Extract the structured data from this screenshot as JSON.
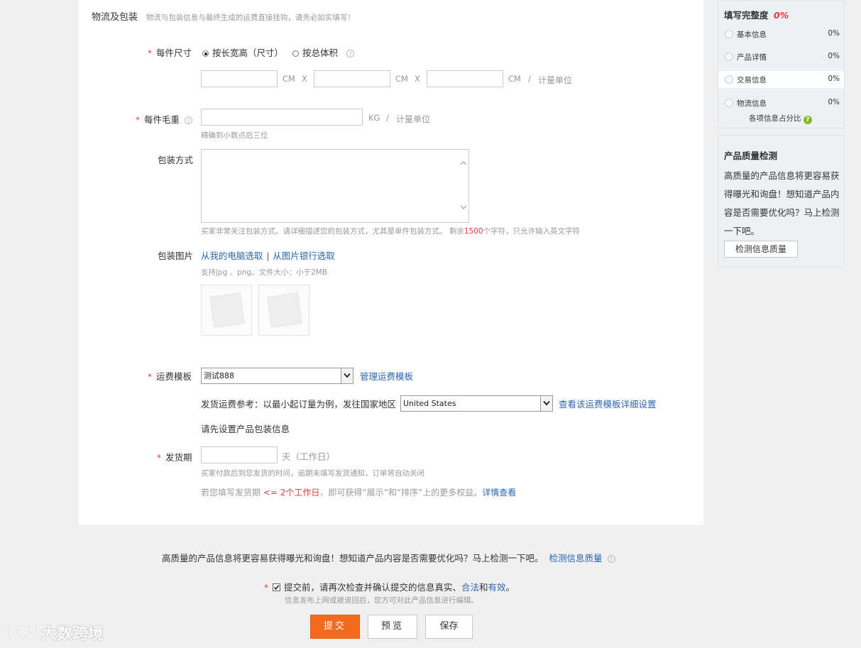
{
  "section": {
    "title": "物流及包装",
    "desc": "物流与包装信息与最终生成的运费直接挂钩，请务必如实填写！"
  },
  "size": {
    "label": "每件尺寸",
    "option_lwh": "按长宽高（尺寸）",
    "option_volume": "按总体积",
    "unit_cm": "CM",
    "times": "X",
    "slash": "/",
    "unit_label": "计量单位"
  },
  "weight": {
    "label": "每件毛重",
    "unit": "KG",
    "slash": "/",
    "unit_label": "计量单位",
    "hint": "精确到小数点后三位"
  },
  "packing": {
    "label": "包装方式",
    "hint_prefix": "买家非常关注包装方式。请详细描述您的包装方式，尤其是单件包装方式。 剩余",
    "remaining": "1500",
    "hint_suffix": "个字符，只允许输入英文字符"
  },
  "images": {
    "label": "包装图片",
    "from_pc": "从我的电脑选取",
    "sep": "|",
    "from_bank": "从图片银行选取",
    "hint": "支持jpg 、png。文件大小：小于2MB"
  },
  "freight": {
    "label": "运费模板",
    "selected": "测试888",
    "manage": "管理运费模板",
    "ref_text": "发货运费参考：以最小起订量为例，发往国家地区",
    "country": "United States",
    "detail_link": "查看该运费模板详细设置",
    "notice": "请先设置产品包装信息"
  },
  "delivery": {
    "label": "发货期",
    "unit": "天（工作日）",
    "hint": "买家付款后到您发货的时间，逾期未填写发货通知，订单将自动关闭",
    "tip_prefix": "若您填写发货期",
    "tip_highlight": "<= 2个工作日",
    "tip_suffix": "，即可获得“展示”和“排序”上的更多权益。",
    "tip_link": "详情查看"
  },
  "bottom": {
    "quality_text": "高质量的产品信息将更容易获得曝光和询盘！想知道产品内容是否需要优化吗？马上检测一下吧。",
    "quality_link": "检测信息质量",
    "confirm_prefix": "提交前，请再次检查并确认提交的信息真实、",
    "confirm_legal": "合法",
    "confirm_and": "和",
    "confirm_valid": "有效",
    "confirm_end": "。",
    "confirm_sub": "信息发布上网或被退回后，您方可对此产品信息进行编辑。",
    "submit": "提交",
    "preview": "预览",
    "save": "保存"
  },
  "sidebar": {
    "completion_title": "填写完整度",
    "completion_value": "0%",
    "items": [
      {
        "label": "基本信息",
        "percent": "0%"
      },
      {
        "label": "产品详情",
        "percent": "0%"
      },
      {
        "label": "交易信息",
        "percent": "0%"
      },
      {
        "label": "物流信息",
        "percent": "0%"
      }
    ],
    "ratio_label": "各项信息占分比",
    "quality_title": "产品质量检测",
    "quality_desc": "高质量的产品信息将更容易获得曝光和询盘！想知道产品内容是否需要优化吗？马上检测一下吧。",
    "quality_button": "检测信息质量"
  },
  "watermark": "大数跨境",
  "colors": {
    "required": "#e4393c",
    "link": "#2a66b4",
    "submit": "#f3691e",
    "help": "#7cbf27"
  }
}
